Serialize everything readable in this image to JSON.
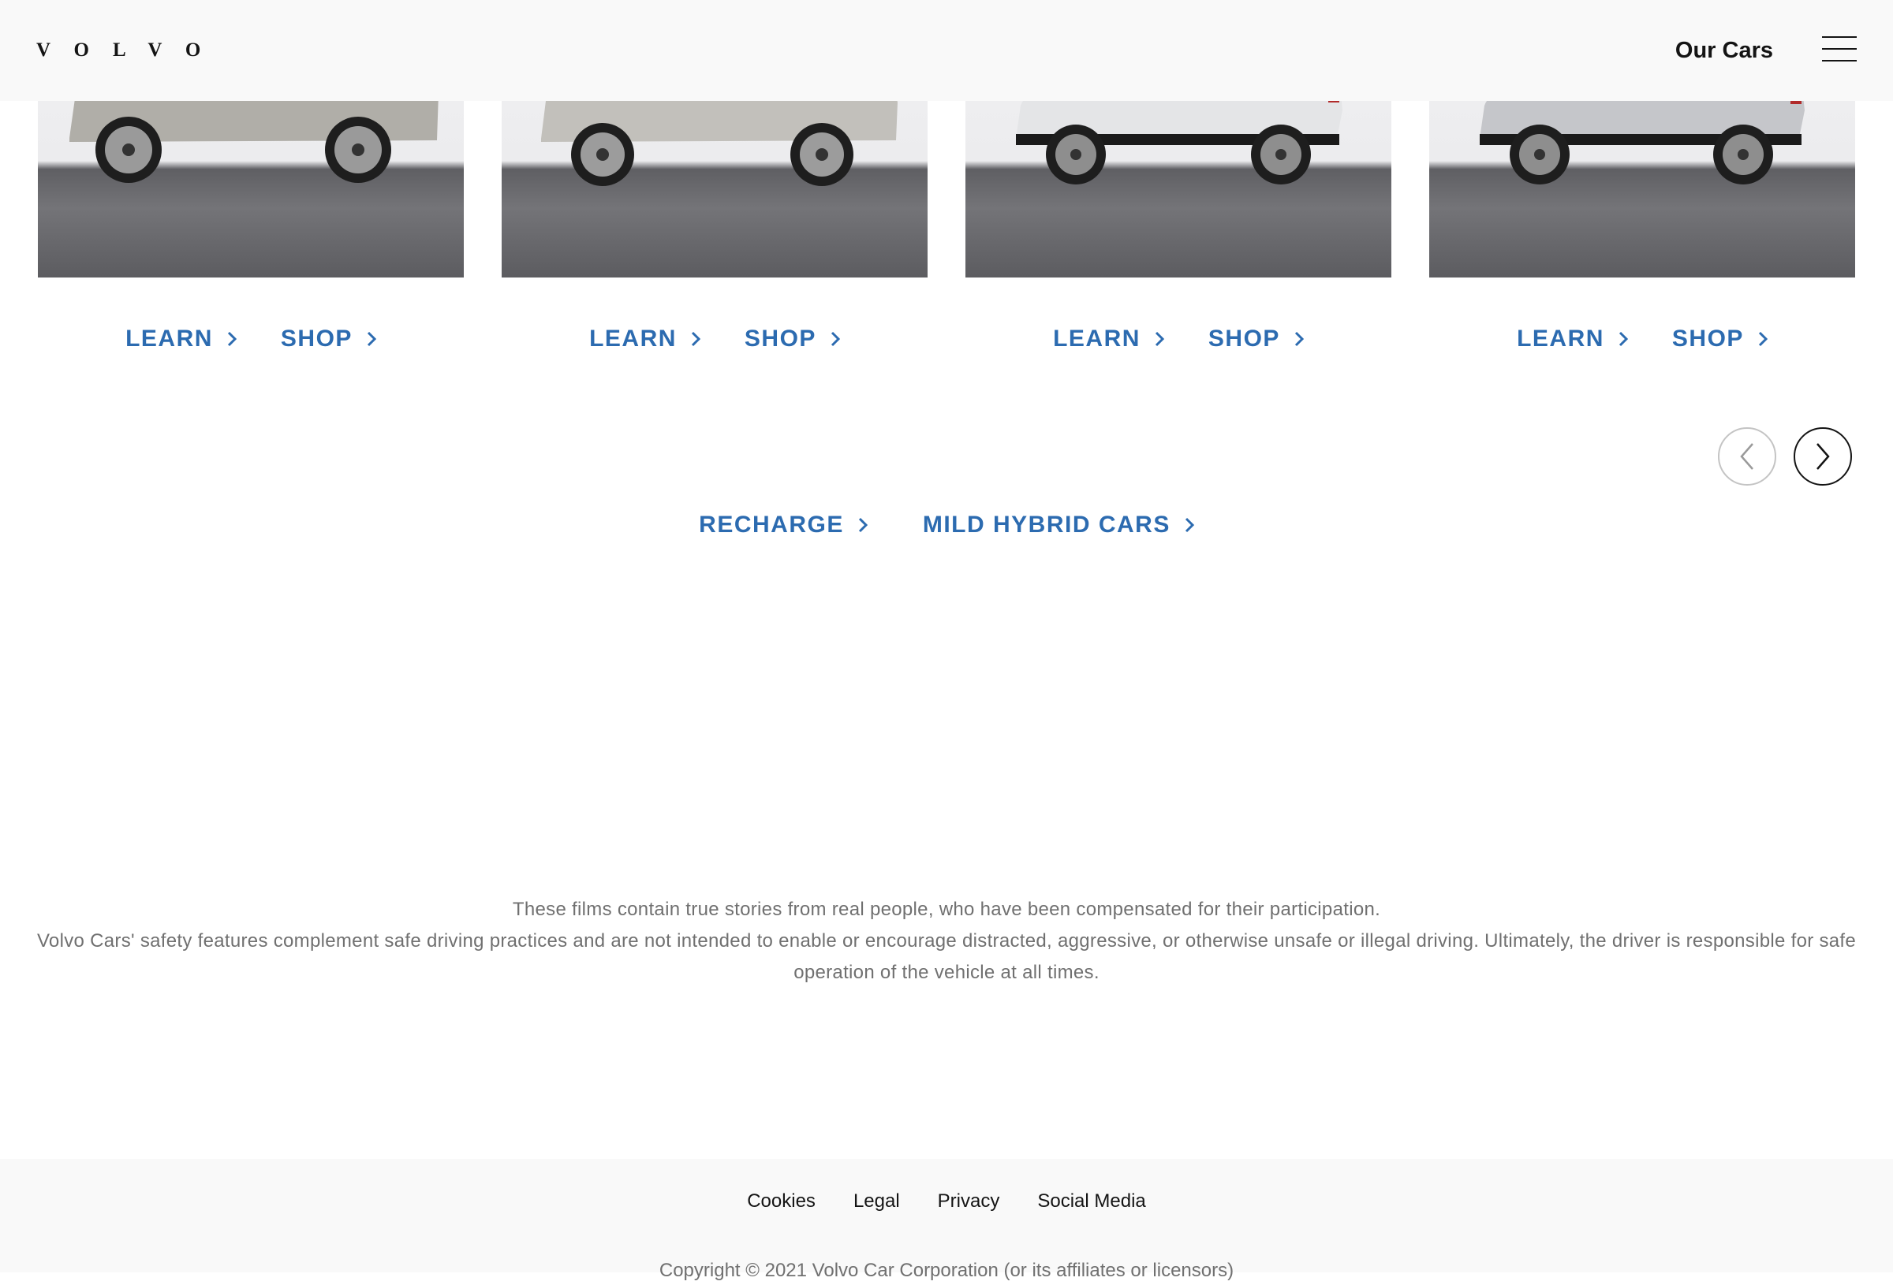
{
  "header": {
    "logo_text": "VOLVO",
    "our_cars_label": "Our Cars",
    "menu_icon": "hamburger-menu-icon"
  },
  "cards": [
    {
      "image_alt": "Volvo XC90 side view, silver",
      "learn_label": "LEARN",
      "shop_label": "SHOP",
      "body_color": "#b0aea8"
    },
    {
      "image_alt": "Volvo XC60 side view, silver",
      "learn_label": "LEARN",
      "shop_label": "SHOP",
      "body_color": "#c2c0bb"
    },
    {
      "image_alt": "Volvo XC40 side view, white",
      "learn_label": "LEARN",
      "shop_label": "SHOP",
      "body_color": "#e4e5e7"
    },
    {
      "image_alt": "Volvo C40 side view, grey",
      "learn_label": "LEARN",
      "shop_label": "SHOP",
      "body_color": "#c5c6ca"
    }
  ],
  "carousel": {
    "prev_icon": "chevron-left-icon",
    "next_icon": "chevron-right-icon"
  },
  "links": {
    "recharge_label": "RECHARGE",
    "mild_hybrid_label": "MILD HYBRID CARS"
  },
  "disclaimer": {
    "line1": "These films contain true stories from real people, who have been compensated for their participation.",
    "line2": "Volvo Cars' safety features complement safe driving practices and are not intended to enable or encourage distracted, aggressive, or otherwise unsafe or illegal driving. Ultimately, the driver is responsible for safe operation of the vehicle at all times."
  },
  "footer": {
    "links": [
      "Cookies",
      "Legal",
      "Privacy",
      "Social Media"
    ],
    "copyright": "Copyright © 2021 Volvo Car Corporation (or its affiliates or licensors)"
  },
  "colors": {
    "link_blue": "#2c6bb0",
    "header_bg": "#f9f9f9",
    "text_dark": "#141414",
    "text_muted": "#707070"
  }
}
